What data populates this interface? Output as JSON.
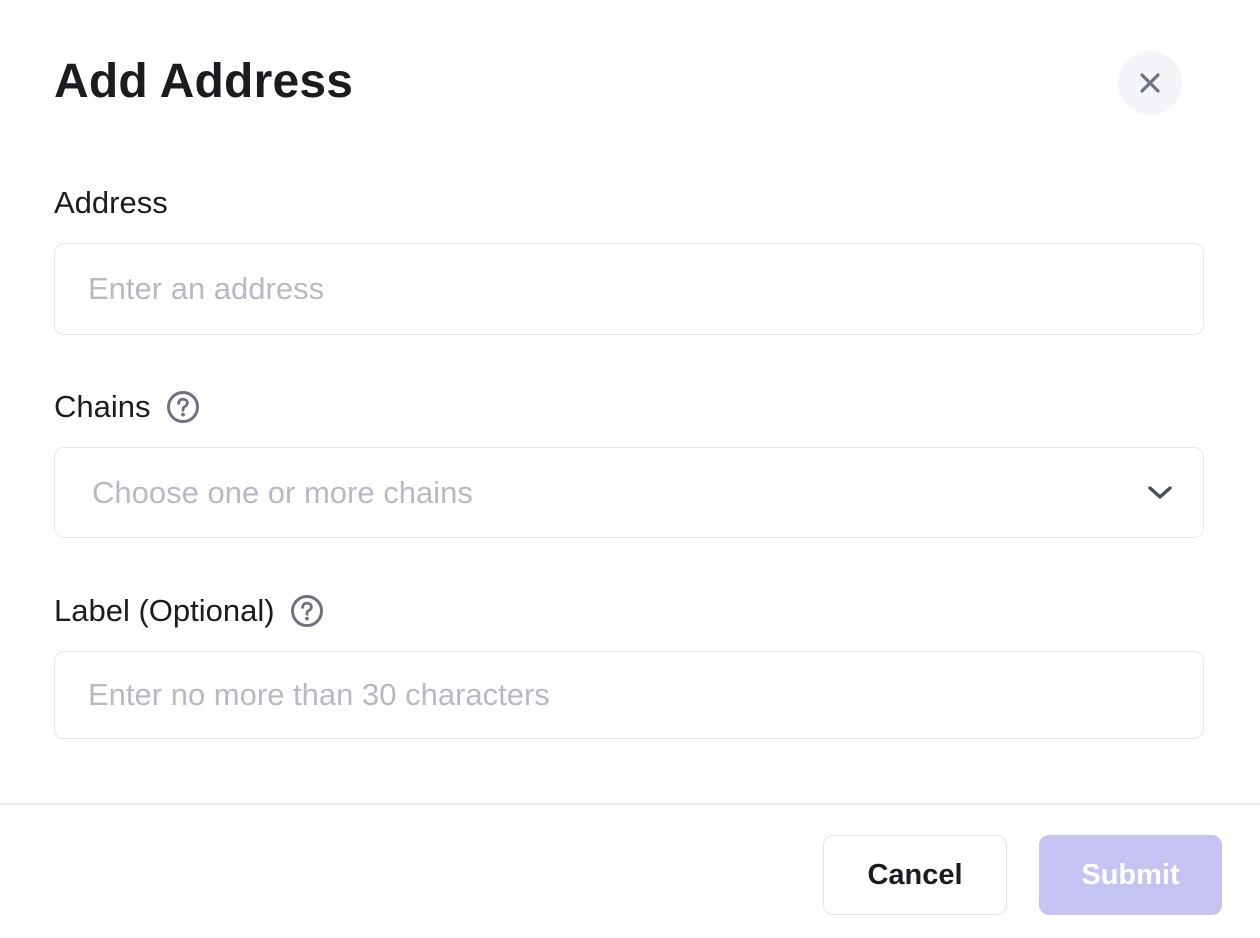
{
  "modal": {
    "title": "Add Address",
    "close_icon": "close-icon"
  },
  "address": {
    "label": "Address",
    "placeholder": "Enter an address",
    "value": ""
  },
  "chains": {
    "label": "Chains",
    "help_icon": "question-circle-icon",
    "placeholder": "Choose one or more chains",
    "dropdown_icon": "chevron-down-icon"
  },
  "label_field": {
    "label": "Label (Optional)",
    "help_icon": "question-circle-icon",
    "placeholder": "Enter no more than 30 characters",
    "value": ""
  },
  "footer": {
    "cancel_label": "Cancel",
    "submit_label": "Submit",
    "submit_disabled": true
  },
  "colors": {
    "text": "#1c1c20",
    "placeholder": "#b8b9c4",
    "border": "#e6e7ec",
    "submit_disabled_bg": "#c4c3f1",
    "close_bg": "#f4f5f9",
    "icon": "#6e7182"
  }
}
